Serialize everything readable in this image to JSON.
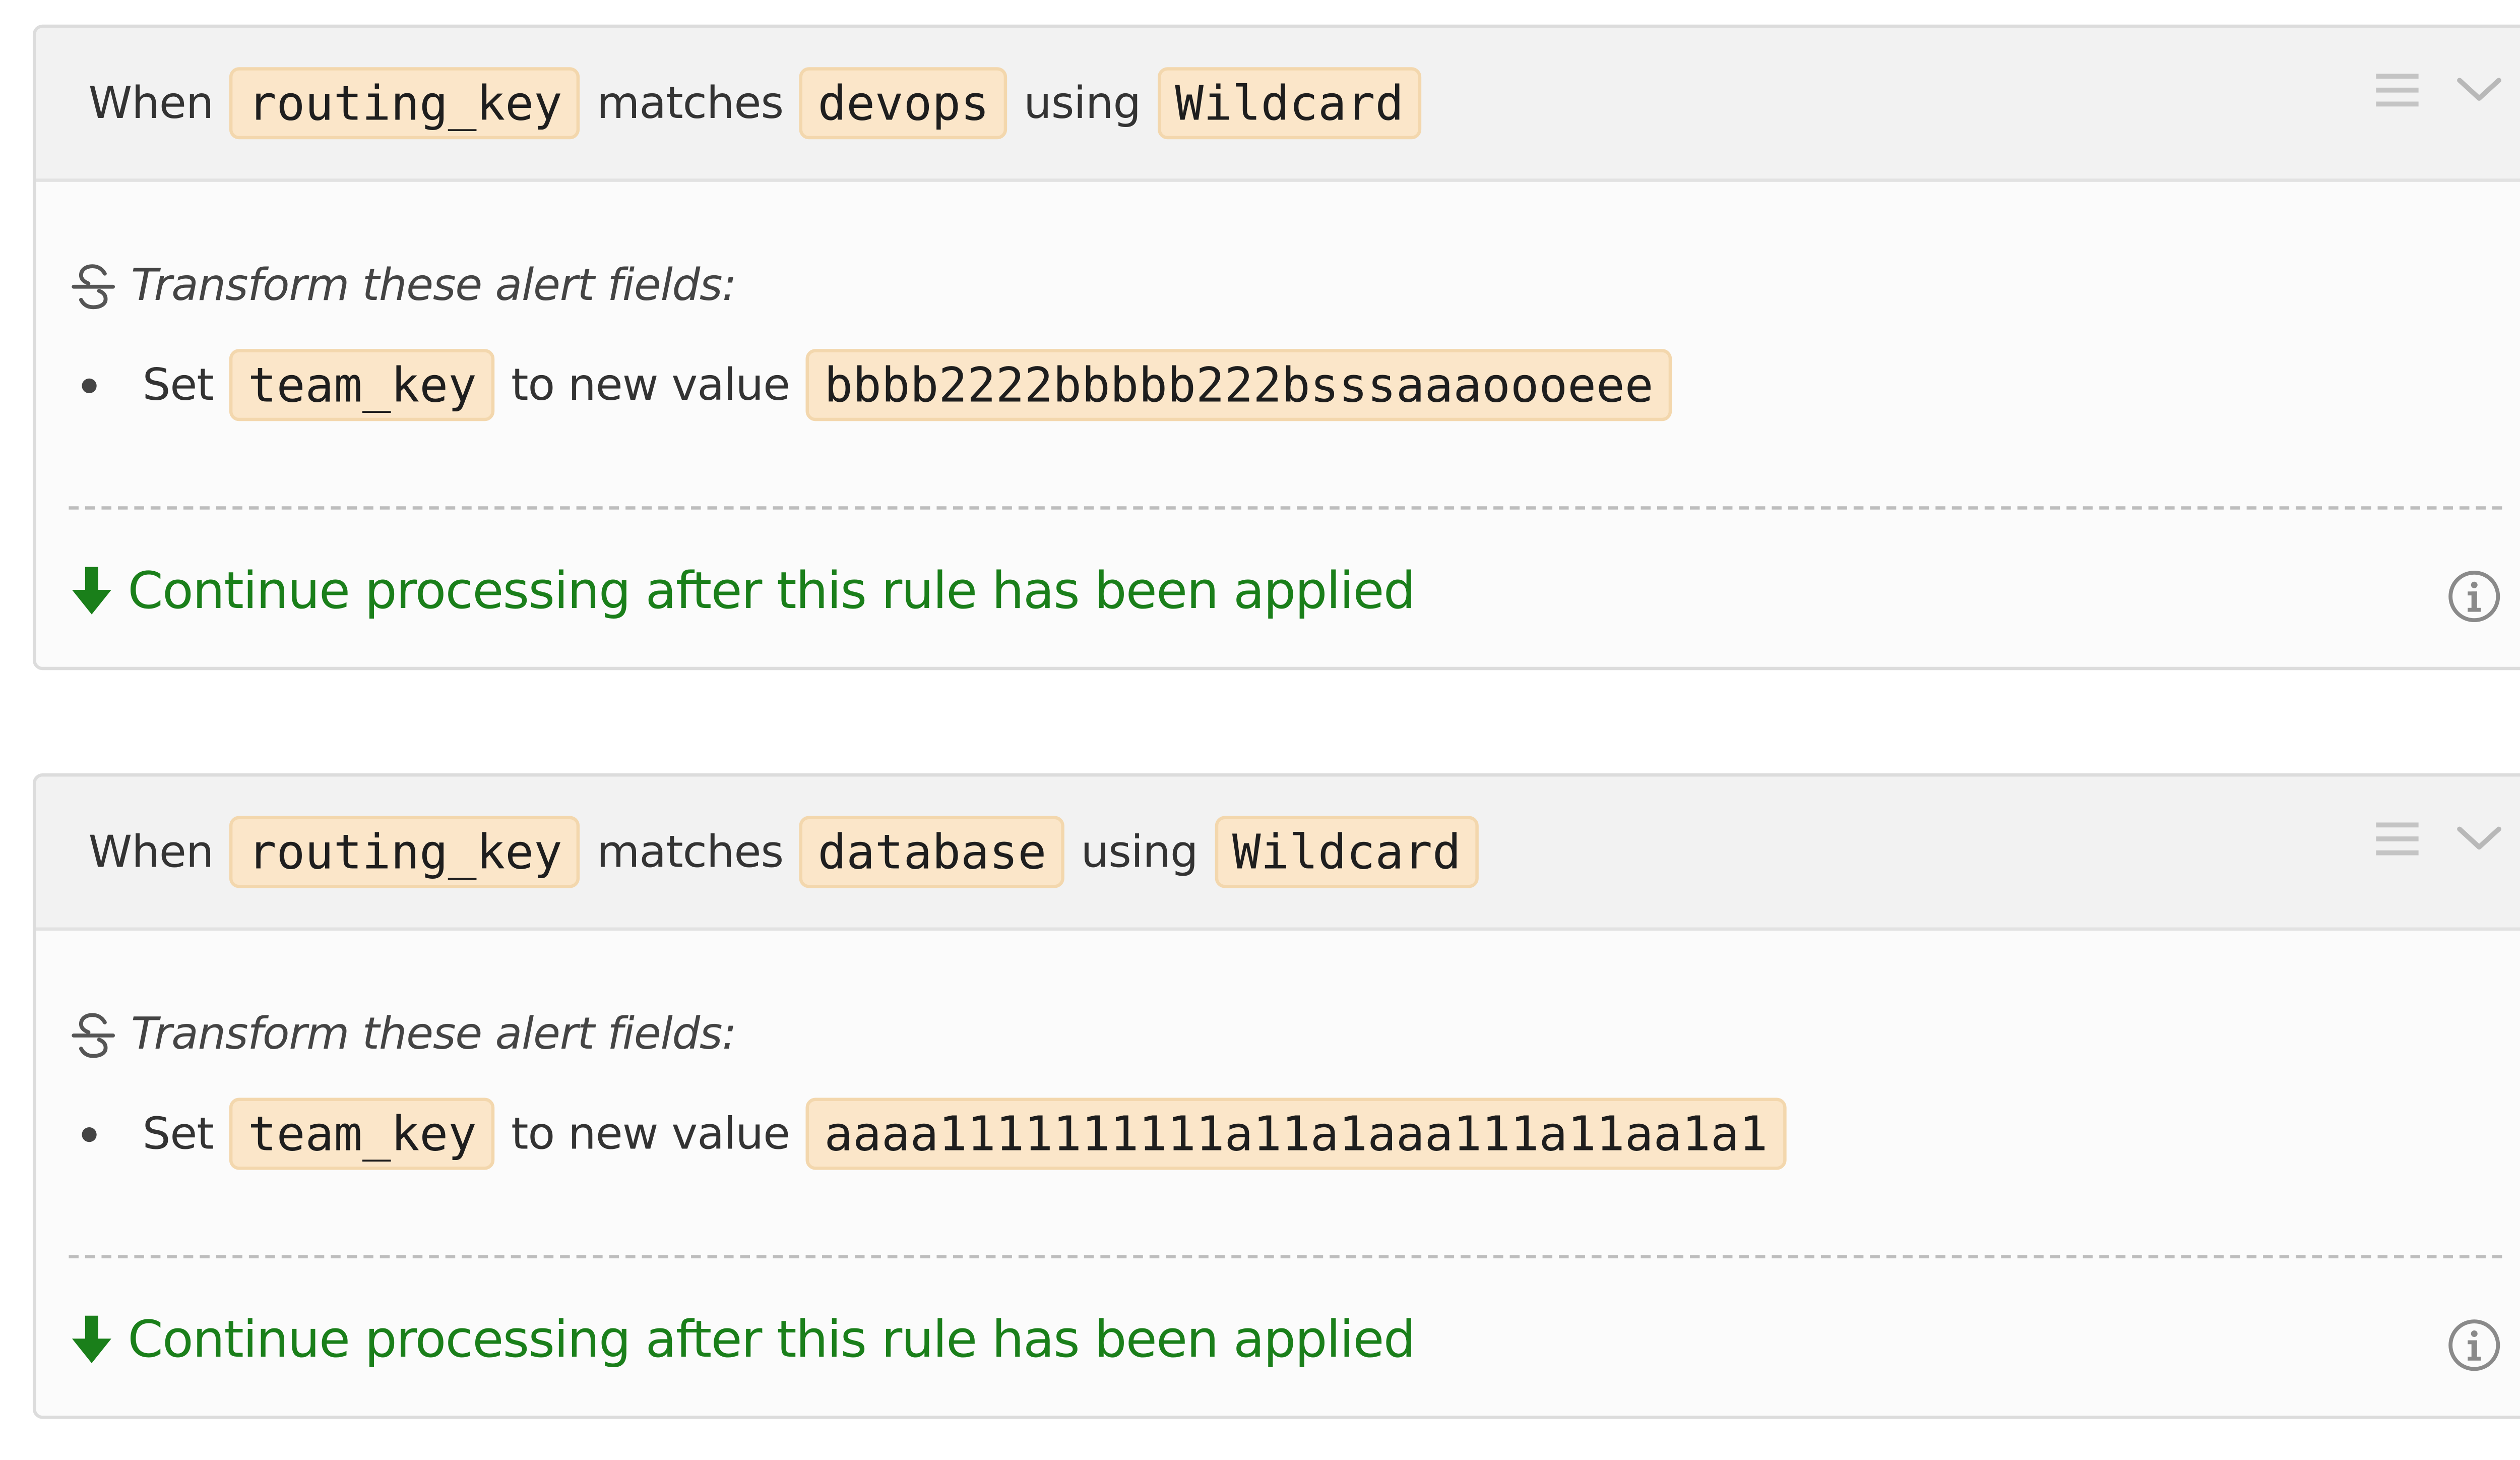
{
  "colors": {
    "token_bg": "#fbe6c9",
    "token_border": "#f3d7ad",
    "continue_green": "#1a7f1a",
    "header_bg": "#f2f2f2",
    "card_border": "#dcdcdc"
  },
  "rules": [
    {
      "when_label": "When",
      "field": "routing_key",
      "matches_label": "matches",
      "pattern": "devops",
      "using_label": "using",
      "match_type": "Wildcard",
      "transform_title": "Transform these alert fields:",
      "set_label": "Set",
      "target_field": "team_key",
      "to_label": "to new value",
      "new_value": "bbbb2222bbbbb222bsssaaaoooeee",
      "continue_text": "Continue processing after this rule has been applied"
    },
    {
      "when_label": "When",
      "field": "routing_key",
      "matches_label": "matches",
      "pattern": "database",
      "using_label": "using",
      "match_type": "Wildcard",
      "transform_title": "Transform these alert fields:",
      "set_label": "Set",
      "target_field": "team_key",
      "to_label": "to new value",
      "new_value": "aaaa1111111111a11a1aaa111a11aa1a1",
      "continue_text": "Continue processing after this rule has been applied"
    }
  ],
  "icons": {
    "drag": "drag-handle-icon",
    "collapse": "chevron-down-icon",
    "transform": "strikethrough-s-icon",
    "continue": "arrow-down-icon",
    "info": "info-icon"
  }
}
